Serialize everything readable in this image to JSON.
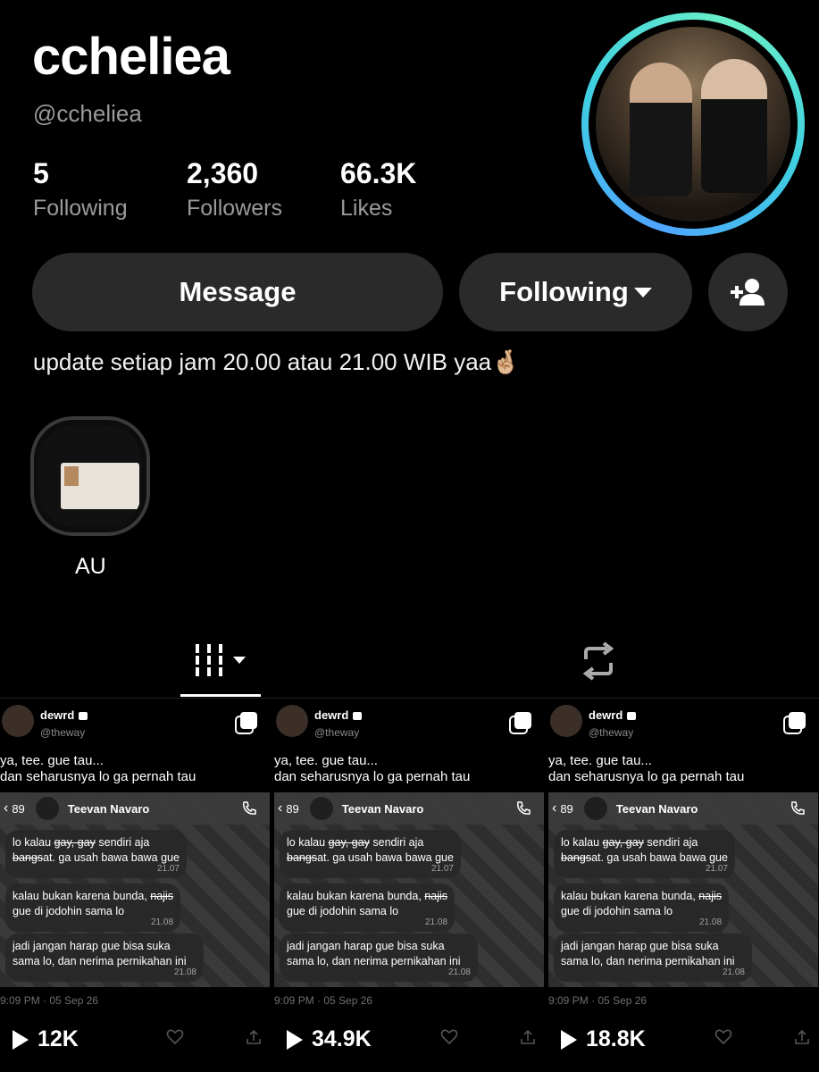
{
  "profile": {
    "display_name": "ccheliea",
    "handle": "@ccheliea",
    "stats": [
      {
        "value": "5",
        "label": "Following"
      },
      {
        "value": "2,360",
        "label": "Followers"
      },
      {
        "value": "66.3K",
        "label": "Likes"
      }
    ],
    "bio": "update setiap jam 20.00 atau 21.00 WIB yaa🤞🏼"
  },
  "buttons": {
    "message": "Message",
    "following": "Following"
  },
  "highlight": {
    "label": "AU"
  },
  "tiles": [
    {
      "user": "dewrd",
      "handle": "@theway",
      "line1": "ya, tee. gue tau...",
      "line2": "dan seharusnya lo ga pernah tau",
      "chat_count": "89",
      "chat_name": "Teevan Navaro",
      "msg1_a": "lo kalau",
      "msg1_s1": "gay, gay",
      "msg1_b": "sendiri aja",
      "msg1_s2": "bangs",
      "msg1_c": "at. ga usah bawa bawa gue",
      "msg1_time": "21.07",
      "msg2_a": "kalau bukan karena bunda,",
      "msg2_s": "najis",
      "msg2_b": "gue di jodohin sama lo",
      "msg2_time": "21.08",
      "msg3": "jadi jangan harap gue bisa suka sama lo, dan nerima pernikahan ini",
      "msg3_time": "21.08",
      "date": "9:09 PM · 05 Sep 26",
      "views": "12K"
    },
    {
      "user": "dewrd",
      "handle": "@theway",
      "line1": "ya, tee. gue tau...",
      "line2": "dan seharusnya lo ga pernah tau",
      "chat_count": "89",
      "chat_name": "Teevan Navaro",
      "msg1_a": "lo kalau",
      "msg1_s1": "gay, gay",
      "msg1_b": "sendiri aja",
      "msg1_s2": "bangs",
      "msg1_c": "at. ga usah bawa bawa gue",
      "msg1_time": "21.07",
      "msg2_a": "kalau bukan karena bunda,",
      "msg2_s": "najis",
      "msg2_b": "gue di jodohin sama lo",
      "msg2_time": "21.08",
      "msg3": "jadi jangan harap gue bisa suka sama lo, dan nerima pernikahan ini",
      "msg3_time": "21.08",
      "date": "9:09 PM · 05 Sep 26",
      "views": "34.9K"
    },
    {
      "user": "dewrd",
      "handle": "@theway",
      "line1": "ya, tee. gue tau...",
      "line2": "dan seharusnya lo ga pernah tau",
      "chat_count": "89",
      "chat_name": "Teevan Navaro",
      "msg1_a": "lo kalau",
      "msg1_s1": "gay, gay",
      "msg1_b": "sendiri aja",
      "msg1_s2": "bangs",
      "msg1_c": "at. ga usah bawa bawa gue",
      "msg1_time": "21.07",
      "msg2_a": "kalau bukan karena bunda,",
      "msg2_s": "najis",
      "msg2_b": "gue di jodohin sama lo",
      "msg2_time": "21.08",
      "msg3": "jadi jangan harap gue bisa suka sama lo, dan nerima pernikahan ini",
      "msg3_time": "21.08",
      "date": "9:09 PM · 05 Sep 26",
      "views": "18.8K"
    }
  ],
  "icons": {
    "add_user": "add-user-icon",
    "grid_tab": "grid-icon",
    "repost_tab": "repost-icon",
    "play": "play-icon",
    "heart": "heart-icon",
    "share": "share-icon",
    "multi": "multi-image-icon"
  },
  "colors": {
    "ring_start": "#4fa4ff",
    "ring_end": "#6af0c8",
    "button_bg": "#2a2a2a",
    "muted": "#9a9a9a"
  }
}
